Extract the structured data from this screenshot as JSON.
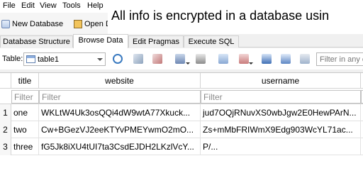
{
  "menu": [
    "File",
    "Edit",
    "View",
    "Tools",
    "Help"
  ],
  "toolbar": {
    "new_database": "New Database",
    "open_database": "Open Dat"
  },
  "banner": "All info is encrypted in a database usin",
  "tabs": [
    "Database Structure",
    "Browse Data",
    "Edit Pragmas",
    "Execute SQL"
  ],
  "active_tab": "Browse Data",
  "browse": {
    "table_label": "Table:",
    "table_name": "table1",
    "filter_all_placeholder": "Filter in any co"
  },
  "grid": {
    "columns": [
      "title",
      "website",
      "username"
    ],
    "filter_placeholder": "Filter",
    "rows": [
      {
        "num": "1",
        "title": "one",
        "website": "WKLtW4Uk3osQQi4dW9wtA77Xkuck...",
        "username": "jud7OQjRNuvXS0wbJgw2E0HewPArN..."
      },
      {
        "num": "2",
        "title": "two",
        "website": "Cw+BGezVJ2eeKTYvPMEYwmO2mO...",
        "username": "Zs+mMbFRIWmX9Edg903WcYL71ac..."
      },
      {
        "num": "3",
        "title": "three",
        "website": "fG5Jk8iXU4tUI7ta3CsdEJDH2LKzlVcY...",
        "username": "P/..."
      }
    ]
  }
}
